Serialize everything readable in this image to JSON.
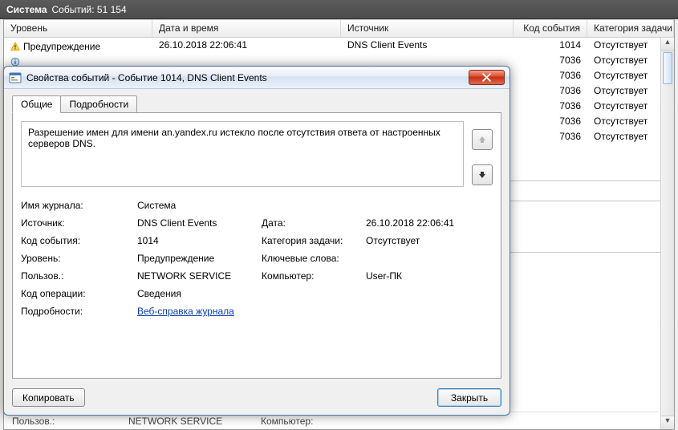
{
  "bg": {
    "title_bold": "Система",
    "title_rest": "Событий: 51 154",
    "columns": {
      "level": "Уровень",
      "date": "Дата и время",
      "source": "Источник",
      "code": "Код события",
      "category": "Категория задачи"
    },
    "rows": [
      {
        "icon": "warning",
        "level": "Предупреждение",
        "date": "26.10.2018 22:06:41",
        "source": "DNS Client Events",
        "code": "1014",
        "category": "Отсутствует"
      },
      {
        "icon": "info",
        "level": "",
        "date": "",
        "source": "",
        "code": "7036",
        "category": "Отсутствует"
      },
      {
        "icon": "",
        "level": "",
        "date": "",
        "source": "",
        "code": "7036",
        "category": "Отсутствует"
      },
      {
        "icon": "",
        "level": "",
        "date": "",
        "source": "",
        "code": "7036",
        "category": "Отсутствует"
      },
      {
        "icon": "",
        "level": "",
        "date": "",
        "source": "",
        "code": "7036",
        "category": "Отсутствует"
      },
      {
        "icon": "",
        "level": "",
        "date": "",
        "source": "",
        "code": "7036",
        "category": "Отсутствует"
      },
      {
        "icon": "",
        "level": "",
        "date": "",
        "source": "",
        "code": "7036",
        "category": "Отсутствует"
      }
    ],
    "bottom_hint": {
      "label": "Пользов.:",
      "value": "NETWORK SERVICE",
      "label2": "Компьютер:",
      "value2": ""
    }
  },
  "dialog": {
    "title": "Свойства событий - Событие 1014, DNS Client Events",
    "tabs": {
      "general": "Общие",
      "details": "Подробности"
    },
    "description": "Разрешение имен для имени an.yandex.ru истекло после отсутствия ответа от настроенных серверов DNS.",
    "labels": {
      "log": "Имя журнала:",
      "source": "Источник:",
      "code": "Код события:",
      "level": "Уровень:",
      "user": "Пользов.:",
      "opcode": "Код операции:",
      "more": "Подробности:",
      "date": "Дата:",
      "category": "Категория задачи:",
      "keywords": "Ключевые слова:",
      "computer": "Компьютер:"
    },
    "values": {
      "log": "Система",
      "source": "DNS Client Events",
      "code": "1014",
      "level": "Предупреждение",
      "user": "NETWORK SERVICE",
      "opcode": "Сведения",
      "date": "26.10.2018 22:06:41",
      "category": "Отсутствует",
      "keywords": "",
      "computer": "User-ПК",
      "help_link": "Веб-справка журнала"
    },
    "buttons": {
      "copy": "Копировать",
      "close": "Закрыть"
    }
  }
}
